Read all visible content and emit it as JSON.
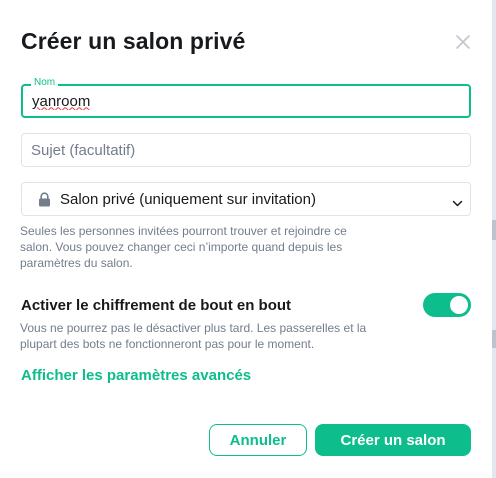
{
  "dialog": {
    "title": "Créer un salon privé",
    "close_icon": "close-icon"
  },
  "name_field": {
    "label": "Nom",
    "value": "yanroom"
  },
  "topic_field": {
    "placeholder": "Sujet (facultatif)",
    "value": ""
  },
  "join_rule": {
    "icon": "lock-icon",
    "selected": "Salon privé (uniquement sur invitation)",
    "chevron_icon": "chevron-down-icon",
    "description": "Seules les personnes invitées pourront trouver et rejoindre ce salon. Vous pouvez changer ceci n’importe quand depuis les paramètres du salon."
  },
  "encryption": {
    "title": "Activer le chiffrement de bout en bout",
    "enabled": true,
    "description": "Vous ne pourrez pas le désactiver plus tard. Les passerelles et la plupart des bots ne fonctionneront pas pour le moment."
  },
  "advanced_link": "Afficher les paramètres avancés",
  "buttons": {
    "cancel": "Annuler",
    "create": "Créer un salon"
  },
  "colors": {
    "accent": "#0dbd8b",
    "text": "#17191c",
    "muted": "#737d8c"
  }
}
